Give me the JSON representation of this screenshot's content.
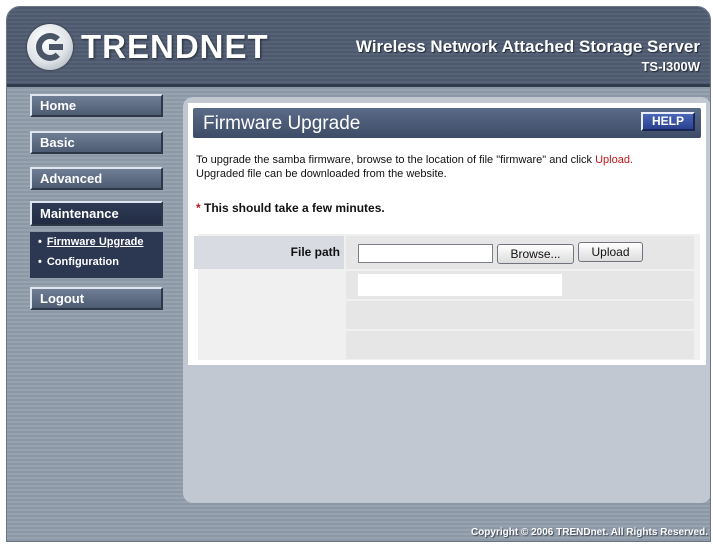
{
  "header": {
    "brand": "TRENDNET",
    "product_title": "Wireless Network Attached Storage Server",
    "model": "TS-I300W"
  },
  "sidebar": {
    "items": [
      {
        "label": "Home"
      },
      {
        "label": "Basic"
      },
      {
        "label": "Advanced"
      },
      {
        "label": "Maintenance"
      },
      {
        "label": "Logout"
      }
    ],
    "submenu": [
      {
        "label": "Firmware Upgrade"
      },
      {
        "label": "Configuration"
      }
    ]
  },
  "main": {
    "title": "Firmware Upgrade",
    "help_label": "HELP",
    "description_part1": "To upgrade the samba firmware, browse to the location of file \"firmware\" and click ",
    "description_link": "Upload.",
    "description_part2": "Upgraded file can be downloaded from the website.",
    "note_star": "*",
    "note_text": " This should take a few minutes.",
    "file_path_label": "File path",
    "file_path_value": "",
    "browse_label": "Browse...",
    "upload_label": "Upload"
  },
  "footer": {
    "copyright": "Copyright © 2006 TRENDnet. All Rights Reserved."
  },
  "colors": {
    "header_bg": "#4e5a6c",
    "nav_active": "#2e3b55",
    "title_bar": "#4a5a76",
    "help_btn": "#2f4a9e",
    "accent_red": "#c0151a"
  }
}
